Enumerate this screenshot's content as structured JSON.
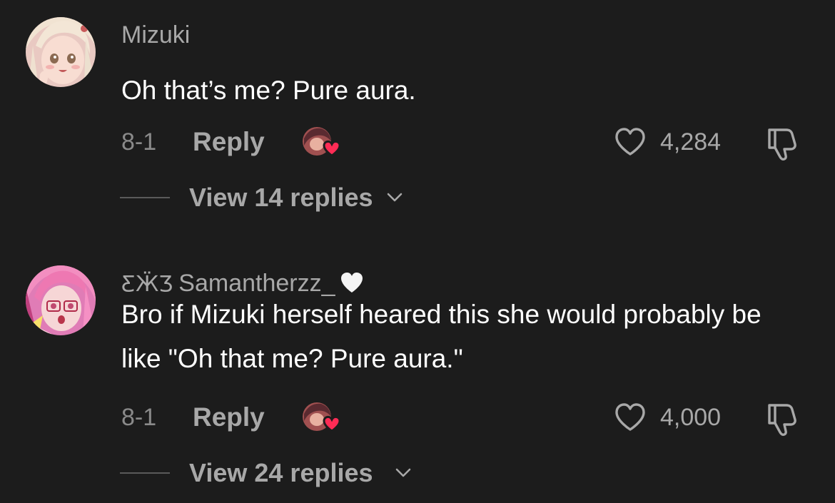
{
  "comments": [
    {
      "username": "Mizuki",
      "text": "Oh that’s me? Pure aura.",
      "date": "8-1",
      "reply_label": "Reply",
      "likes": "4,284",
      "view_replies": "View 14 replies",
      "avatar_icon": "anime-girl-blonde-avatar",
      "colors": {
        "skin": "#f6dcd0",
        "hair": "#efe2cf",
        "bg": "#eac8c0"
      }
    },
    {
      "username_prefix": "ƸӜƷ",
      "username": "Samantherzz_",
      "username_suffix_icon": "white-heart-emoji",
      "text": "Bro if Mizuki herself heared this she would probably be like \"Oh that me? Pure aura.\"",
      "date": "8-1",
      "reply_label": "Reply",
      "likes": "4,000",
      "view_replies": "View 24 replies",
      "avatar_icon": "anime-girl-pink-avatar",
      "colors": {
        "hair": "#f07ab0",
        "bg": "#e27eb8"
      }
    }
  ],
  "theme": {
    "background": "#1c1c1c",
    "primary_text": "#ffffff",
    "secondary_text": "#a8a8a8",
    "creator_heart": "#fe2c55"
  }
}
